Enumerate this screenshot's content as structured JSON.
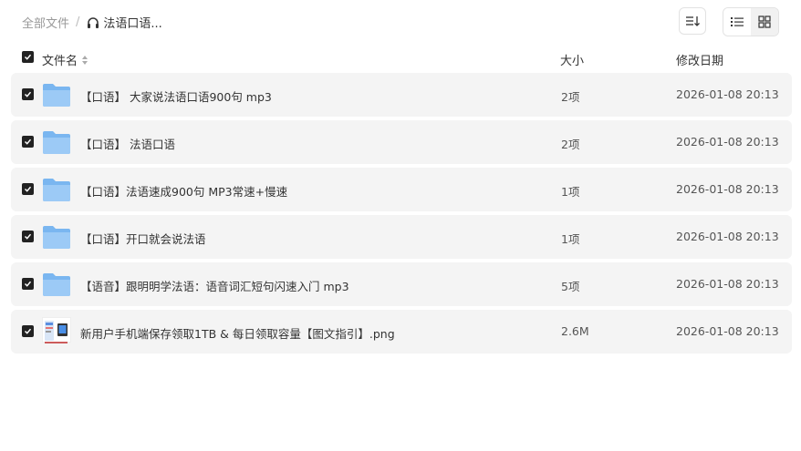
{
  "breadcrumb": {
    "root": "全部文件",
    "separator": "/",
    "current": "法语口语..."
  },
  "header": {
    "name": "文件名",
    "size": "大小",
    "date": "修改日期"
  },
  "rows": [
    {
      "name": "【口语】 大家说法语口语900句 mp3",
      "size": "2项",
      "date": "2026-01-08 20:13",
      "type": "folder",
      "checked": true
    },
    {
      "name": "【口语】 法语口语",
      "size": "2项",
      "date": "2026-01-08 20:13",
      "type": "folder",
      "checked": true
    },
    {
      "name": "【口语】法语速成900句 MP3常速+慢速",
      "size": "1项",
      "date": "2026-01-08 20:13",
      "type": "folder",
      "checked": true
    },
    {
      "name": "【口语】开口就会说法语",
      "size": "1项",
      "date": "2026-01-08 20:13",
      "type": "folder",
      "checked": true
    },
    {
      "name": "【语音】跟明明学法语：语音词汇短句闪速入门 mp3",
      "size": "5项",
      "date": "2026-01-08 20:13",
      "type": "folder",
      "checked": true
    },
    {
      "name": "新用户手机端保存领取1TB & 每日领取容量【图文指引】.png",
      "size": "2.6M",
      "date": "2026-01-08 20:13",
      "type": "image",
      "checked": true
    }
  ],
  "colors": {
    "folder": "#7ab6f0",
    "checkbox": "#222222",
    "row_bg": "#f4f4f4"
  },
  "icons": {
    "sort": "sort-icon",
    "list_view": "list-view-icon",
    "grid_view": "grid-view-icon",
    "breadcrumb": "headphones-icon"
  }
}
